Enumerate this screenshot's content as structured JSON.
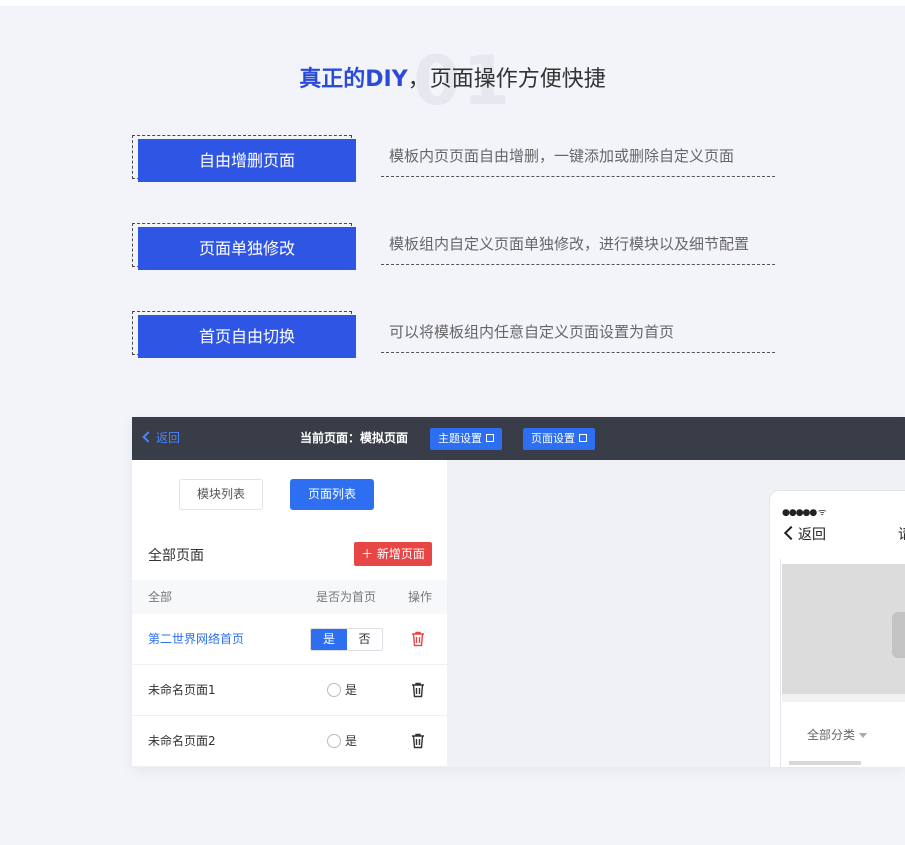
{
  "heading": {
    "number": "01",
    "highlight": "真正的DIY",
    "rest": "，页面操作方便快捷"
  },
  "features": [
    {
      "label": "自由增删页面",
      "desc": "模板内页页面自由增删，一键添加或删除自定义页面"
    },
    {
      "label": "页面单独修改",
      "desc": "模板组内自定义页面单独修改，进行模块以及细节配置"
    },
    {
      "label": "首页自由切换",
      "desc": "可以将模板组内任意自定义页面设置为首页"
    }
  ],
  "app": {
    "topbar": {
      "back": "返回",
      "current_page": "当前页面：模拟页面",
      "theme_btn": "主题设置",
      "page_btn": "页面设置"
    },
    "tabs": {
      "modules": "模块列表",
      "pages": "页面列表"
    },
    "all_pages": "全部页面",
    "add_page": "新增页面",
    "table_headers": {
      "all": "全部",
      "is_home": "是否为首页",
      "action": "操作"
    },
    "rows": [
      {
        "name": "第二世界网络首页",
        "yes": "是",
        "no": "否"
      },
      {
        "name": "未命名页面1",
        "yes": "是"
      },
      {
        "name": "未命名页面2",
        "yes": "是"
      }
    ],
    "phone": {
      "status": "●●●●● ᯤ",
      "back": "返回",
      "title": "请",
      "category": "全部分类"
    },
    "colors": {
      "accent": "#2d6ff0",
      "primary_button": "#2f55e4",
      "danger": "#e84545",
      "topbar": "#383d47",
      "heading_highlight": "#2a4ad8"
    }
  }
}
